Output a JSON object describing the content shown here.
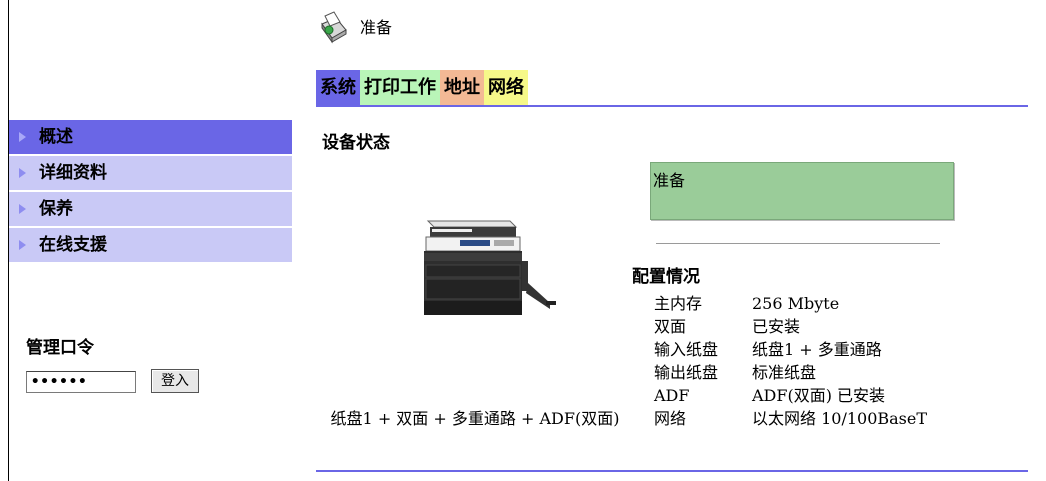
{
  "header": {
    "status_text": "准备",
    "status_icon": "printer-ready-icon"
  },
  "tabs": [
    {
      "label": "系统",
      "color": "#6a66e6",
      "active": true
    },
    {
      "label": "打印工作",
      "color": "#b9f5b8",
      "active": false
    },
    {
      "label": "地址",
      "color": "#f3b995",
      "active": false
    },
    {
      "label": "网络",
      "color": "#f6f889",
      "active": false
    }
  ],
  "sidebar": {
    "items": [
      {
        "label": "概述",
        "active": true
      },
      {
        "label": "详细资料",
        "active": false
      },
      {
        "label": "保养",
        "active": false
      },
      {
        "label": "在线支援",
        "active": false
      }
    ]
  },
  "login": {
    "title": "管理口令",
    "password_value": "••••••",
    "button_label": "登入"
  },
  "main": {
    "section_title": "设备状态",
    "status_box_text": "准备",
    "status_box_color": "#9acc99",
    "config_title": "配置情况",
    "config": [
      {
        "label": "主内存",
        "value": "256 Mbyte"
      },
      {
        "label": "双面",
        "value": "已安装"
      },
      {
        "label": "输入纸盘",
        "value": "纸盘1 + 多重通路"
      },
      {
        "label": "输出纸盘",
        "value": "标准纸盘"
      },
      {
        "label": "ADF",
        "value": "ADF(双面) 已安装"
      },
      {
        "label": "网络",
        "value": "以太网络 10/100BaseT"
      }
    ],
    "caption": "纸盘1 + 双面 + 多重通路 + ADF(双面)"
  }
}
